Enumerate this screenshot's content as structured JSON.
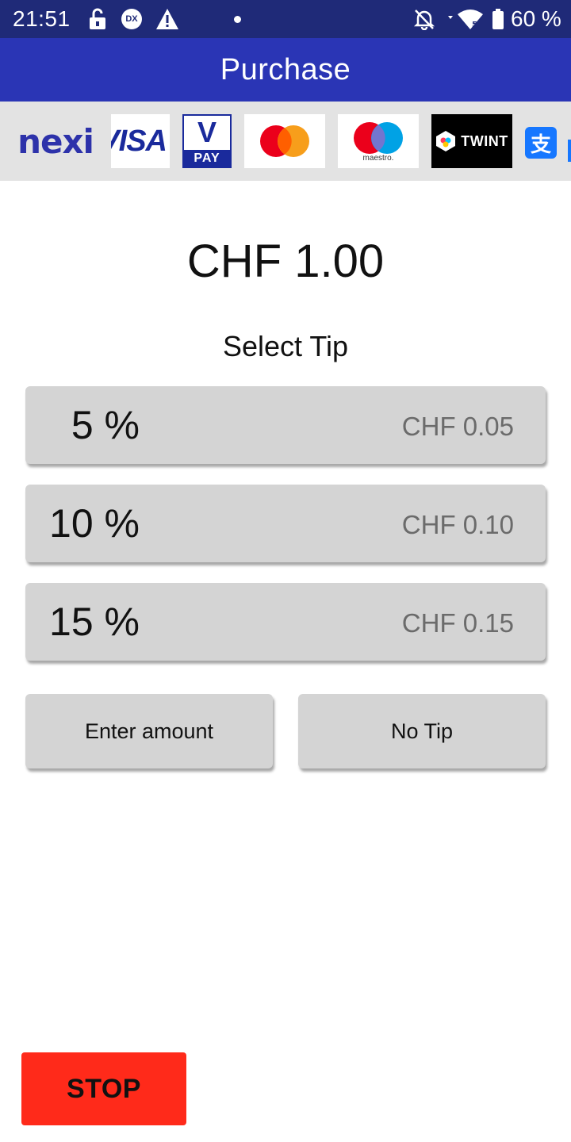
{
  "status_bar": {
    "time": "21:51",
    "battery": "60 %",
    "dx_badge": "DX",
    "icons": [
      "lock-open-icon",
      "dx-icon",
      "warning-icon",
      "notification-dot-icon",
      "bell-off-icon",
      "wifi-icon",
      "battery-icon"
    ]
  },
  "app_bar": {
    "title": "Purchase",
    "color": "#2a35b5"
  },
  "payment_logos": {
    "nexi": "nexi",
    "visa": "VISA",
    "vpay_v": "V",
    "vpay_pay": "PAY",
    "maestro": "maestro.",
    "twint": "TWINT",
    "alipay": "支"
  },
  "amount": "CHF 1.00",
  "select_tip_label": "Select Tip",
  "tips": [
    {
      "percent": "5 %",
      "value": "CHF 0.05"
    },
    {
      "percent": "10 %",
      "value": "CHF 0.10"
    },
    {
      "percent": "15 %",
      "value": "CHF 0.15"
    }
  ],
  "buttons": {
    "enter_amount": "Enter amount",
    "no_tip": "No Tip",
    "stop": "STOP"
  },
  "colors": {
    "status_bar": "#1f2a78",
    "button_gray": "#d4d4d4",
    "stop_red": "#ff2a1a"
  }
}
